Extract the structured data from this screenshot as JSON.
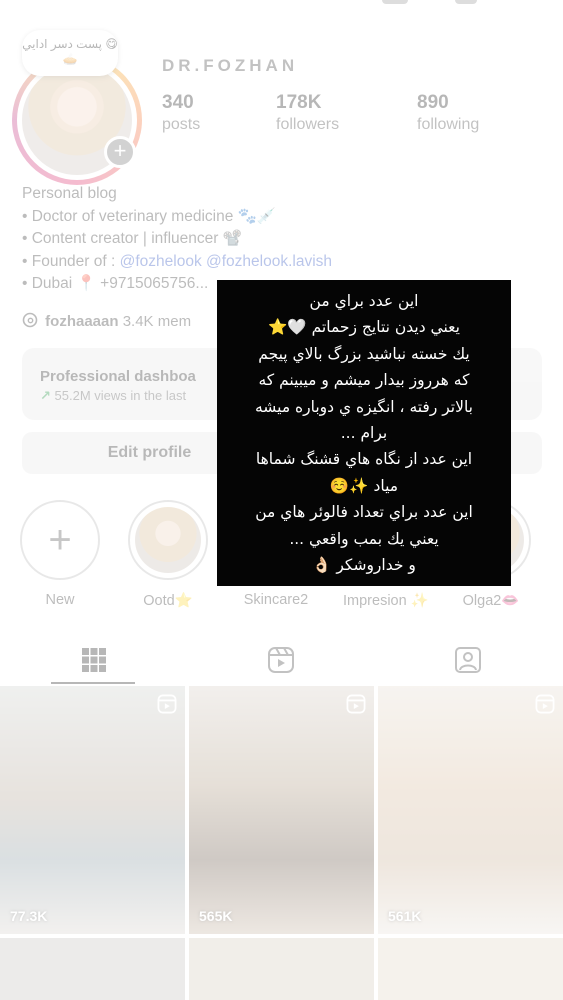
{
  "profile": {
    "username": "DR.FOZHAN",
    "note": "پست دسر ادایي 😋🥧",
    "stats": [
      {
        "value": "340",
        "label": "posts"
      },
      {
        "value": "178K",
        "label": "followers"
      },
      {
        "value": "890",
        "label": "following"
      }
    ],
    "bio": {
      "category": "Personal blog",
      "line1": "• Doctor of veterinary medicine 🐾💉",
      "line2": "• Content creator | influencer 📽️",
      "line3_prefix": "• Founder of : ",
      "line3_links": "@fozhelook @fozhelook.lavish",
      "line4": "• Dubai 📍 +9715065756..."
    },
    "threads": {
      "handle": "fozhaaaan",
      "count": "3.4K mem"
    }
  },
  "dashboard": {
    "title": "Professional dashboa",
    "arrow": "↗",
    "value": "55.2M",
    "sub": "views in the last"
  },
  "buttons": {
    "edit_profile": "Edit profile"
  },
  "highlights": [
    {
      "label": "New",
      "type": "new"
    },
    {
      "label": "Ootd⭐",
      "type": "photo"
    },
    {
      "label": "Skincare2",
      "type": "photo"
    },
    {
      "label": "Impresion ✨",
      "type": "photo"
    },
    {
      "label": "Olga2👄",
      "type": "photo"
    }
  ],
  "tabs": [
    {
      "icon": "grid-icon",
      "active": true
    },
    {
      "icon": "reels-icon",
      "active": false
    },
    {
      "icon": "tagged-icon",
      "active": false
    }
  ],
  "grid": [
    {
      "views": "77.3K",
      "icon": "reel-icon"
    },
    {
      "views": "565K",
      "icon": "reel-icon"
    },
    {
      "views": "561K",
      "icon": "reel-icon"
    }
  ],
  "story_text": {
    "lines": [
      "اين عدد براي من",
      "يعني ديدن نتايج زحماتم 🤍⭐",
      "يك خسته نباشيد بزرگ بالاي پيجم",
      "كه هرروز بيدار ميشم و ميبينم كه",
      "بالاتر رفته ، انگيزه ي دوباره ميشه",
      "برام ...",
      "اين عدد از نگاه هاي قشنگ شماها",
      "مياد ✨☺️",
      "اين عدد براي تعداد فالوئر هاي من",
      "يعني يك بمب واقعي ...",
      "و خداروشكر 👌🏻"
    ]
  }
}
